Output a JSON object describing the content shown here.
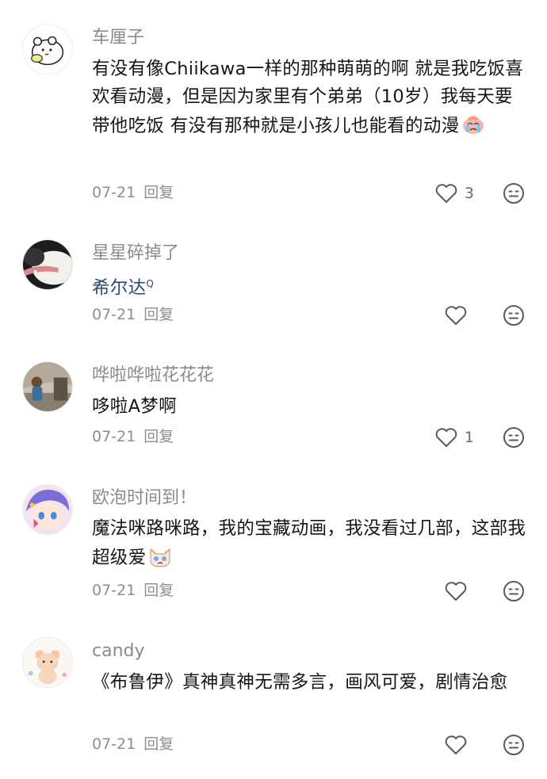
{
  "comments": [
    {
      "username": "车厘子",
      "text": "有没有像Chiikawa一样的那种萌萌的啊 就是我吃饭喜欢看动漫，但是因为家里有个弟弟（10岁）我每天要带他吃饭 有没有那种就是小孩儿也能看的动漫",
      "emoji": "crying-face-emoji",
      "date": "07-21",
      "reply_label": "回复",
      "likes": "3",
      "avatar": "white-bear-avatar"
    },
    {
      "username": "星星碎掉了",
      "text": "希尔达",
      "link_marker": "Q",
      "date": "07-21",
      "reply_label": "回复",
      "likes": "",
      "avatar": "pet-photo-avatar"
    },
    {
      "username": "哗啦哗啦花花花",
      "text": "哆啦A梦啊",
      "date": "07-21",
      "reply_label": "回复",
      "likes": "1",
      "avatar": "person-photo-avatar"
    },
    {
      "username": "欧泡时间到！",
      "text": "魔法咪路咪路，我的宝藏动画，我没看过几部，这部我超级爱",
      "emoji": "crying-cat-emoji",
      "date": "07-21",
      "reply_label": "回复",
      "likes": "",
      "avatar": "anime-girl-avatar"
    },
    {
      "username": "candy",
      "text": "《布鲁伊》真神真神无需多言，画风可爱，剧情治愈",
      "date": "07-21",
      "reply_label": "回复",
      "likes": "",
      "avatar": "bear-doll-avatar"
    }
  ],
  "icons": {
    "like": "heart-outline-icon",
    "dislike": "neutral-face-icon"
  },
  "colors": {
    "username": "#8a8a8a",
    "text": "#161616",
    "link": "#2a4a78",
    "meta": "#8e8e8e",
    "icon": "#5a5a5a"
  }
}
